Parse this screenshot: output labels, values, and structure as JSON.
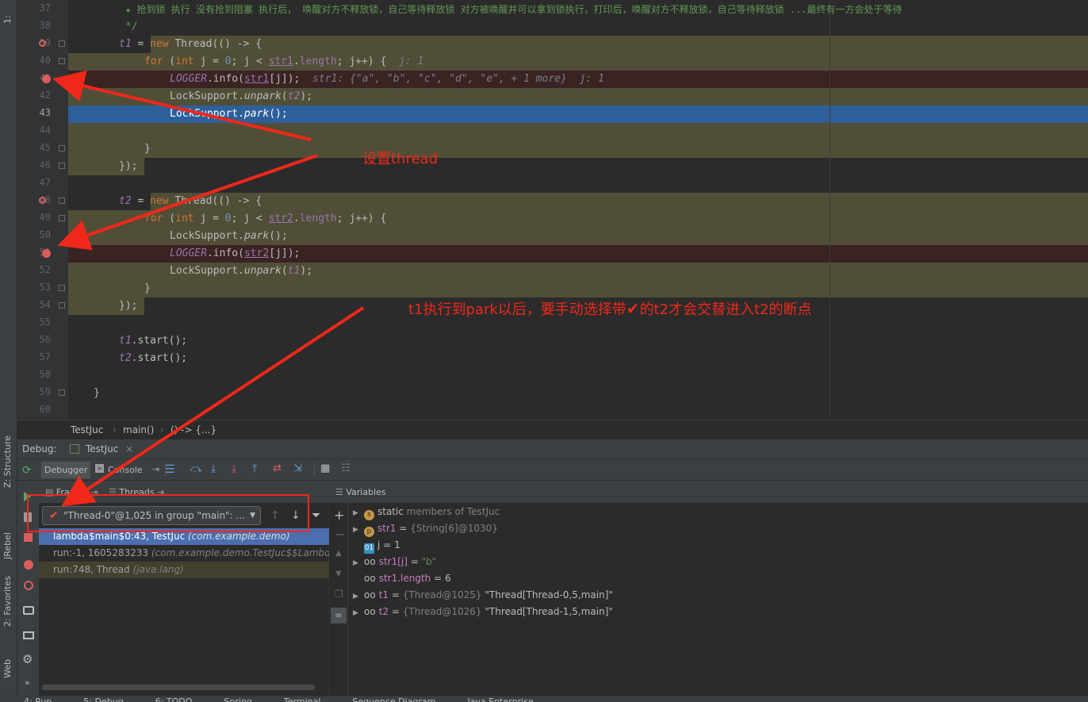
{
  "left_strip": {
    "structure": "Z: Structure",
    "jrebel": "JRebel",
    "favorites": "2: Favorites",
    "web": "Web"
  },
  "editor": {
    "lines": [
      {
        "n": "37",
        "text": "★ 抢到锁 执行 没有抢到阻塞 执行后， 唤醒对方不释放锁，自己等待释放锁 对方被唤醒并可以拿到锁执行，打印后，唤醒对方不释放锁，自己等待释放锁 ...最终有一方会处于等待"
      },
      {
        "n": "38",
        "text": "*/"
      },
      {
        "n": "39",
        "text": "t1 = new Thread(() -> {"
      },
      {
        "n": "40",
        "text": "for (int j = 0; j < str1.length; j++) {",
        "hint": "j: 1"
      },
      {
        "n": "41",
        "text": "LOGGER.info(str1[j]);",
        "hint": "str1: {\"a\", \"b\", \"c\", \"d\", \"e\", + 1 more}  j: 1"
      },
      {
        "n": "42",
        "text": "LockSupport.unpark(t2);"
      },
      {
        "n": "43",
        "text": "LockSupport.park();"
      },
      {
        "n": "44",
        "text": ""
      },
      {
        "n": "45",
        "text": "}"
      },
      {
        "n": "46",
        "text": "});"
      },
      {
        "n": "47",
        "text": ""
      },
      {
        "n": "48",
        "text": "t2 = new Thread(() -> {"
      },
      {
        "n": "49",
        "text": "for (int j = 0; j < str2.length; j++) {"
      },
      {
        "n": "50",
        "text": "LockSupport.park();"
      },
      {
        "n": "51",
        "text": "LOGGER.info(str2[j]);"
      },
      {
        "n": "52",
        "text": "LockSupport.unpark(t1);"
      },
      {
        "n": "53",
        "text": "}"
      },
      {
        "n": "54",
        "text": "});"
      },
      {
        "n": "55",
        "text": ""
      },
      {
        "n": "56",
        "text": "t1.start();"
      },
      {
        "n": "57",
        "text": "t2.start();"
      },
      {
        "n": "58",
        "text": ""
      },
      {
        "n": "59",
        "text": "}"
      },
      {
        "n": "60",
        "text": ""
      }
    ]
  },
  "breadcrumb": {
    "file": "TestJuc",
    "method": "main()",
    "lambda": "() -> {...}"
  },
  "debug": {
    "title": "Debug:",
    "config": "TestJuc",
    "tab_debugger": "Debugger",
    "tab_console": "Console",
    "tab_frames": "Frames",
    "tab_threads": "Threads",
    "thread_selector": "\"Thread-0\"@1,025 in group \"main\": ...",
    "variables_title": "Variables",
    "frames": [
      {
        "main": "lambda$main$0:43, TestJuc",
        "pkg": "(com.example.demo)"
      },
      {
        "main": "run:-1, 1605283233",
        "pkg": "(com.example.demo.TestJuc$$Lambda$"
      },
      {
        "main": "run:748, Thread",
        "pkg": "(java.lang)"
      }
    ],
    "variables": [
      {
        "name": "static",
        "rest": "members of TestJuc"
      },
      {
        "name": "str1",
        "eq": "=",
        "val": "{String[6]@1030}"
      },
      {
        "name": "j",
        "eq": "=",
        "val": "1"
      },
      {
        "name": "str1[j]",
        "eq": "=",
        "val": "\"b\""
      },
      {
        "name": "str1.length",
        "eq": "=",
        "val": "6"
      },
      {
        "name": "t1",
        "eq": "=",
        "val": "{Thread@1025}",
        "extra": "\"Thread[Thread-0,5,main]\""
      },
      {
        "name": "t2",
        "eq": "=",
        "val": "{Thread@1026}",
        "extra": "\"Thread[Thread-1,5,main]\""
      }
    ]
  },
  "annotations": {
    "a1": "设置thread",
    "a2_pre": "t1执行到park以后，要手动选择带",
    "a2_post": "的t2才会交替进入t2的断点"
  },
  "bottom_tabs": [
    "4: Run",
    "5: Debug",
    "6: TODO",
    "Spring",
    "Terminal",
    "Sequence Diagram",
    "Java Enterprise"
  ]
}
